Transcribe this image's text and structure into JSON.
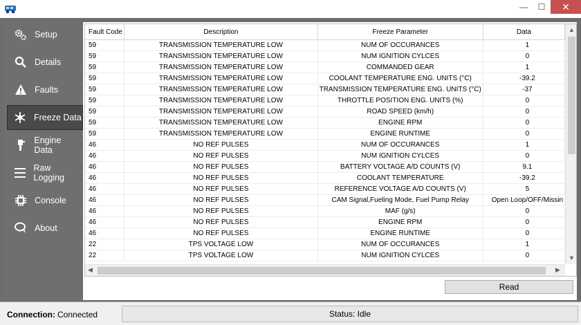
{
  "window": {
    "min_symbol": "—",
    "max_symbol": "☐",
    "close_symbol": "✕"
  },
  "sidebar": {
    "items": [
      {
        "label": "Setup",
        "icon": "gears-icon"
      },
      {
        "label": "Details",
        "icon": "magnifier-icon"
      },
      {
        "label": "Faults",
        "icon": "warning-icon"
      },
      {
        "label": "Freeze Data",
        "icon": "snowflake-icon"
      },
      {
        "label": "Engine Data",
        "icon": "engine-icon"
      },
      {
        "label": "Raw Logging",
        "icon": "lines-icon"
      },
      {
        "label": "Console",
        "icon": "chip-icon"
      },
      {
        "label": "About",
        "icon": "chat-icon"
      }
    ],
    "active_index": 3
  },
  "grid": {
    "columns": [
      "Fault Code",
      "Description",
      "Freeze Parameter",
      "Data"
    ],
    "rows": [
      [
        "59",
        "TRANSMISSION TEMPERATURE LOW",
        "NUM OF OCCURANCES",
        "1"
      ],
      [
        "59",
        "TRANSMISSION TEMPERATURE LOW",
        "NUM IGNITION CYLCES",
        "0"
      ],
      [
        "59",
        "TRANSMISSION TEMPERATURE LOW",
        "COMMANDED GEAR",
        "1"
      ],
      [
        "59",
        "TRANSMISSION TEMPERATURE LOW",
        "COOLANT TEMPERATURE ENG. UNITS (°C)",
        "-39.2"
      ],
      [
        "59",
        "TRANSMISSION TEMPERATURE LOW",
        "TRANSMISSION TEMPERATURE ENG. UNITS (°C)",
        "-37"
      ],
      [
        "59",
        "TRANSMISSION TEMPERATURE LOW",
        "THROTTLE POSITION ENG. UNITS (%)",
        "0"
      ],
      [
        "59",
        "TRANSMISSION TEMPERATURE LOW",
        "ROAD SPEED (km/h)",
        "0"
      ],
      [
        "59",
        "TRANSMISSION TEMPERATURE LOW",
        "ENGINE RPM",
        "0"
      ],
      [
        "59",
        "TRANSMISSION TEMPERATURE LOW",
        "ENGINE RUNTIME",
        "0"
      ],
      [
        "46",
        "NO REF PULSES",
        "NUM OF OCCURANCES",
        "1"
      ],
      [
        "46",
        "NO REF PULSES",
        "NUM IGNITION CYLCES",
        "0"
      ],
      [
        "46",
        "NO REF PULSES",
        "BATTERY VOLTAGE A/D COUNTS (V)",
        "9.1"
      ],
      [
        "46",
        "NO REF PULSES",
        "COOLANT TEMPERATURE",
        "-39.2"
      ],
      [
        "46",
        "NO REF PULSES",
        "REFERENCE VOLTAGE A/D COUNTS (V)",
        "5"
      ],
      [
        "46",
        "NO REF PULSES",
        "CAM Signal,Fueling Mode, Fuel Pump Relay",
        "Open Loop/OFF/Missin"
      ],
      [
        "46",
        "NO REF PULSES",
        "MAF (g/s)",
        "0"
      ],
      [
        "46",
        "NO REF PULSES",
        "ENGINE RPM",
        "0"
      ],
      [
        "46",
        "NO REF PULSES",
        "ENGINE RUNTIME",
        "0"
      ],
      [
        "22",
        "TPS VOLTAGE LOW",
        "NUM OF OCCURANCES",
        "1"
      ],
      [
        "22",
        "TPS VOLTAGE LOW",
        "NUM IGNITION CYLCES",
        "0"
      ]
    ]
  },
  "read_button": "Read",
  "statusbar": {
    "connection_label": "Connection:",
    "connection_value": "Connected",
    "status_text": "Status: Idle"
  },
  "colors": {
    "sidebar_bg": "#6f6f6f",
    "active_item_bg": "#4a4a4a",
    "close_button": "#c75050"
  }
}
